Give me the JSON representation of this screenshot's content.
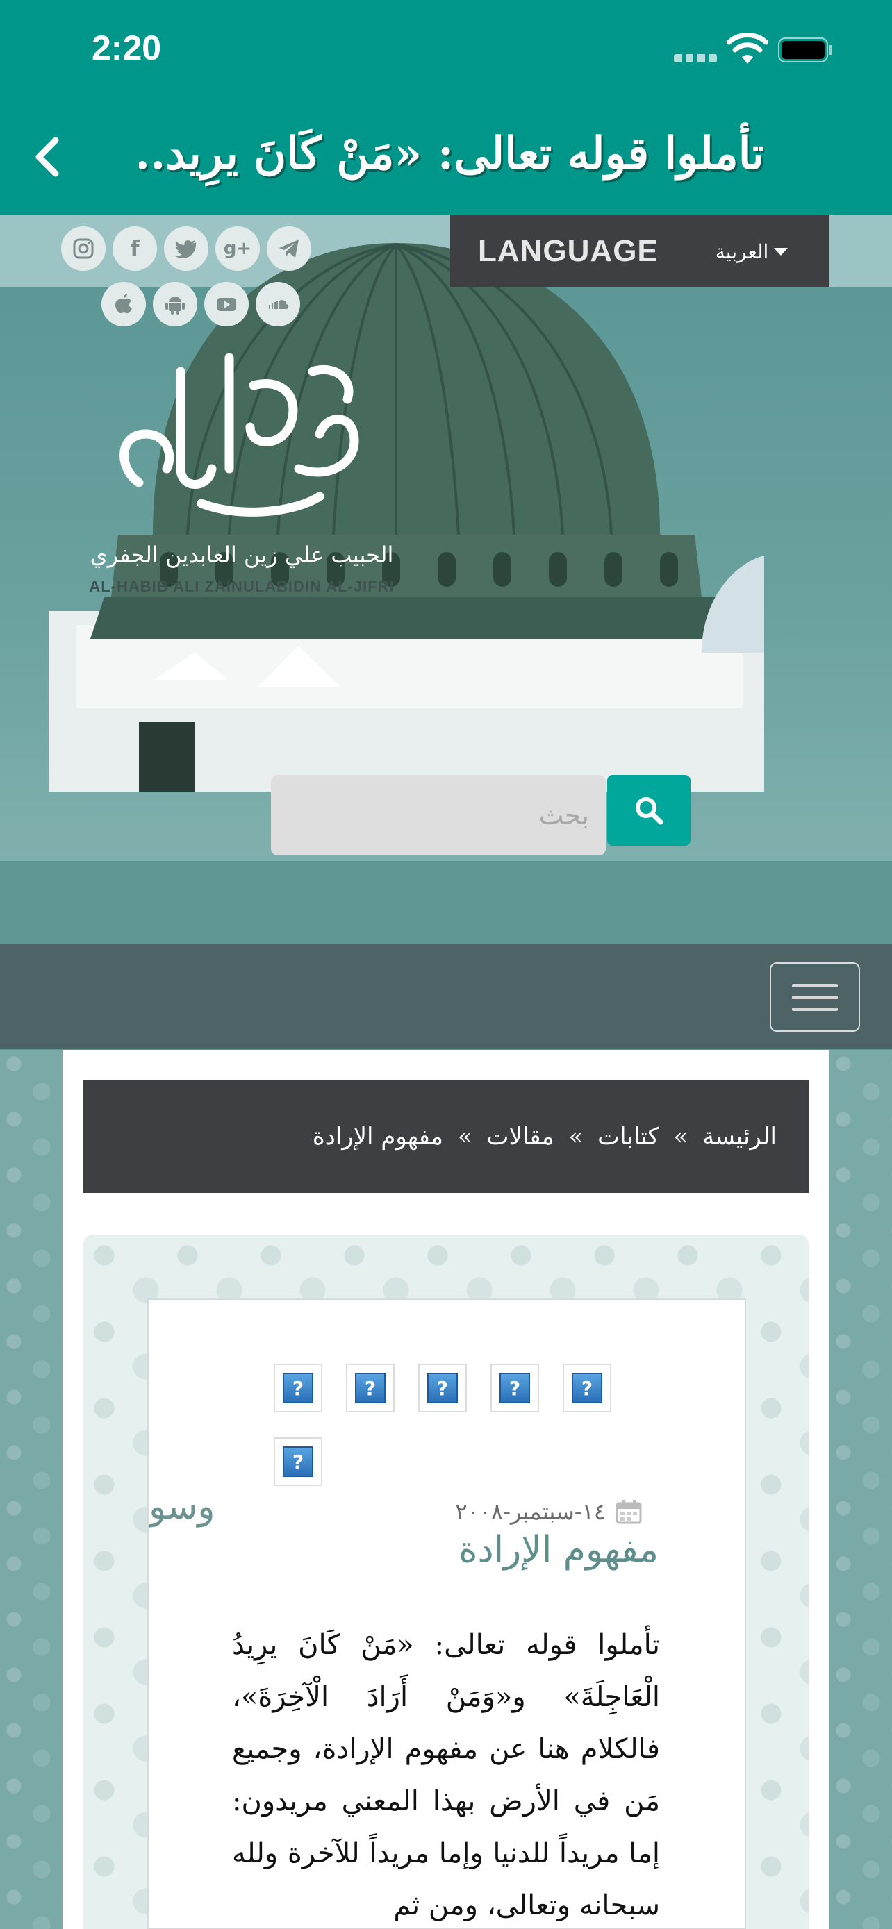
{
  "status_bar": {
    "time": "2:20"
  },
  "app_header": {
    "title": "تأملوا قوله تعالى: «مَنْ كَانَ يرِيد..."
  },
  "social": {
    "row1": [
      {
        "icon": "telegram-icon"
      },
      {
        "icon": "google-plus-icon",
        "glyph": "g+"
      },
      {
        "icon": "twitter-icon"
      },
      {
        "icon": "facebook-icon",
        "glyph": "f"
      },
      {
        "icon": "instagram-icon"
      }
    ],
    "row2": [
      {
        "icon": "soundcloud-icon"
      },
      {
        "icon": "youtube-icon"
      },
      {
        "icon": "android-icon"
      },
      {
        "icon": "apple-icon"
      }
    ]
  },
  "language": {
    "label": "LANGUAGE",
    "selected": "العربية"
  },
  "logo": {
    "arabic_name": "علي الجفري",
    "full_name": "الحبيب علي زين العابدين الجفري",
    "english_name": "AL-HABIB ALI ZAINULABIDIN AL-JIFRI"
  },
  "search": {
    "placeholder": "بحث"
  },
  "breadcrumb": {
    "items": [
      "الرئيسة",
      "كتابات",
      "مقالات",
      "مفهوم الإرادة"
    ],
    "separator": "»"
  },
  "article": {
    "thumb_glyph": "?",
    "date": "١٤-سبتمبر-٢٠٠٨",
    "clipped_text": "وسو",
    "title": "مفهوم الإرادة",
    "body": "تأملوا قوله تعالى: «مَنْ كَانَ يرِيدُ الْعَاجِلَةَ» و«وَمَنْ أَرَادَ الْآخِرَةَ»، فالكلام هنا عن مفهوم الإرادة، وجميع مَن في الأرض بهذا المعني مريدون: إما مريداً للدنيا وإما مريداً للآخرة ولله سبحانه وتعالى، ومن ثم"
  },
  "colors": {
    "brand_teal": "#00978a",
    "dark_bar": "#3d3f43",
    "search_button": "#00a79a",
    "title_text": "#5e8f8c"
  }
}
